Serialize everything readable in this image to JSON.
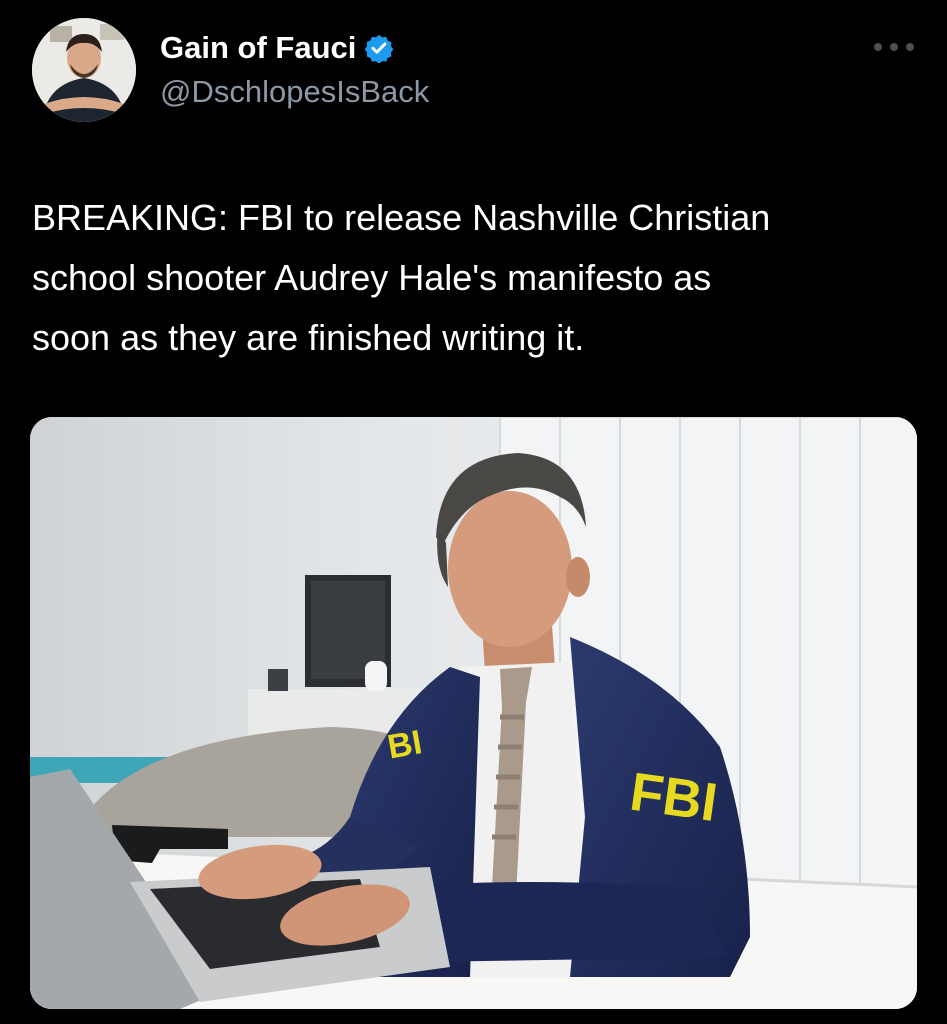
{
  "author": {
    "display_name": "Gain of Fauci",
    "handle": "@DschlopesIsBack",
    "verified": true,
    "avatar_icon": "profile-photo"
  },
  "tweet": {
    "text": "BREAKING:  FBI to release Nashville Christian\nschool shooter Audrey Hale's manifesto as\nsoon as they are finished writing it."
  },
  "media": {
    "type": "photo",
    "jacket_lettering": "FBI"
  },
  "colors": {
    "background": "#000000",
    "text": "#ffffff",
    "secondary_text": "#8b98a5",
    "verified_blue": "#1d9bf0",
    "jacket_navy": "#1f2a55",
    "fbi_yellow": "#e6d91f"
  },
  "icons": {
    "verified": "verified-badge-icon",
    "more": "more-options-icon"
  }
}
